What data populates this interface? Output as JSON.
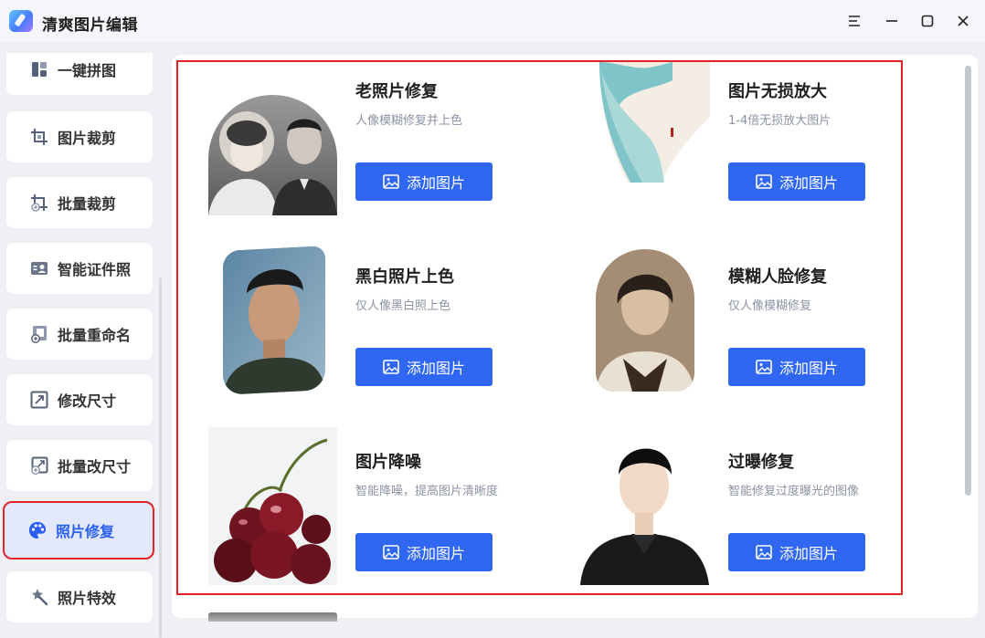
{
  "app": {
    "title": "清爽图片编辑"
  },
  "sidebar": {
    "items": [
      {
        "label": "一键拼图",
        "icon": "collage-icon"
      },
      {
        "label": "图片裁剪",
        "icon": "crop-icon"
      },
      {
        "label": "批量裁剪",
        "icon": "batch-crop-icon"
      },
      {
        "label": "智能证件照",
        "icon": "id-photo-icon"
      },
      {
        "label": "批量重命名",
        "icon": "batch-rename-icon"
      },
      {
        "label": "修改尺寸",
        "icon": "resize-icon"
      },
      {
        "label": "批量改尺寸",
        "icon": "batch-resize-icon"
      },
      {
        "label": "照片修复",
        "icon": "palette-icon",
        "active": true
      },
      {
        "label": "照片特效",
        "icon": "magic-wand-icon"
      }
    ]
  },
  "cards": [
    {
      "title": "老照片修复",
      "desc": "人像模糊修复并上色",
      "button": "添加图片"
    },
    {
      "title": "图片无损放大",
      "desc": "1-4倍无损放大图片",
      "button": "添加图片"
    },
    {
      "title": "黑白照片上色",
      "desc": "仅人像黑白照上色",
      "button": "添加图片"
    },
    {
      "title": "模糊人脸修复",
      "desc": "仅人像模糊修复",
      "button": "添加图片"
    },
    {
      "title": "图片降噪",
      "desc": "智能降噪，提高图片清晰度",
      "button": "添加图片"
    },
    {
      "title": "过曝修复",
      "desc": "智能修复过度曝光的图像",
      "button": "添加图片"
    }
  ],
  "colors": {
    "accent": "#2f66f2",
    "highlight": "#e0242a",
    "active_bg": "#e3e9fb"
  }
}
